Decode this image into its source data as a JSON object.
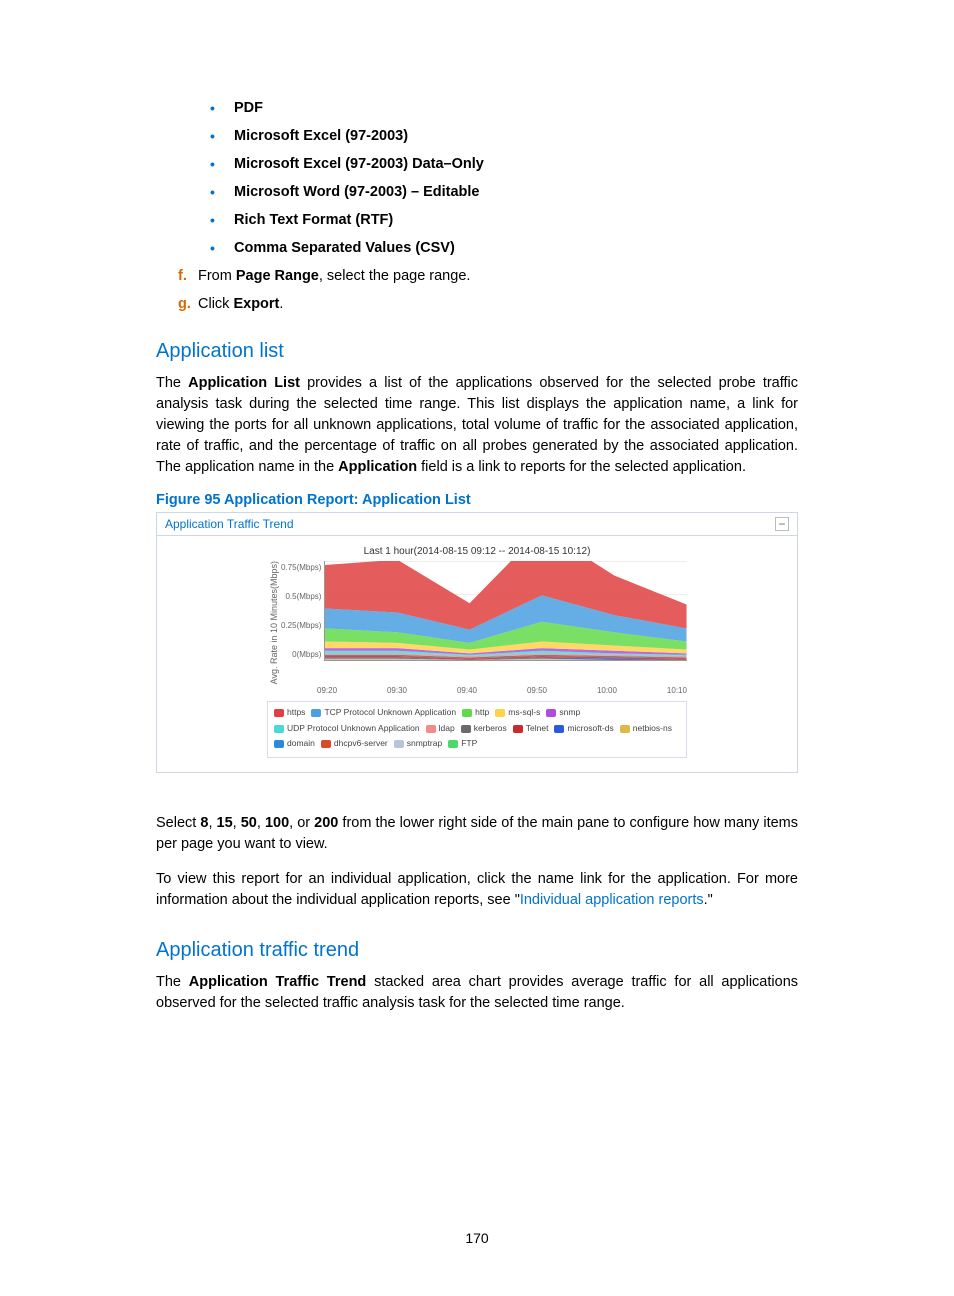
{
  "formats": [
    "PDF",
    "Microsoft Excel (97-2003)",
    "Microsoft Excel (97-2003) Data–Only",
    "Microsoft Word (97-2003) – Editable",
    "Rich Text Format (RTF)",
    "Comma Separated Values (CSV)"
  ],
  "steps": {
    "f": {
      "letter": "f.",
      "prefix": "From ",
      "bold": "Page Range",
      "suffix": ", select the page range."
    },
    "g": {
      "letter": "g.",
      "prefix": "Click ",
      "bold": "Export",
      "suffix": "."
    }
  },
  "section1": {
    "title": "Application list",
    "para_before_bold1": "The ",
    "bold1": "Application List",
    "para_mid": " provides a list of the applications observed for the selected probe traffic analysis task during the selected time range. This list displays the application name, a link for viewing the ports for all unknown applications, total volume of traffic for the associated application, rate of traffic, and the percentage of traffic on all probes generated by the associated application. The application name in the ",
    "bold2": "Application",
    "para_after_bold2": " field is a link to reports for the selected application."
  },
  "figure_caption": "Figure 95 Application Report: Application List",
  "panel_title": "Application Traffic Trend",
  "chart_data": {
    "type": "area",
    "title": "Last 1 hour(2014-08-15 09:12 -- 2014-08-15 10:12)",
    "ylabel": "Avg. Rate in 10 Minutes(Mbps)",
    "y_ticks": [
      "0.75(Mbps)",
      "0.5(Mbps)",
      "0.25(Mbps)",
      "0(Mbps)"
    ],
    "ylim": [
      0,
      0.75
    ],
    "x_ticks": [
      "09:20",
      "09:30",
      "09:40",
      "09:50",
      "10:00",
      "10:10"
    ],
    "x": [
      0,
      0.2,
      0.4,
      0.6,
      0.8,
      1.0
    ],
    "series": [
      {
        "name": "https",
        "color": "#e04040",
        "values": [
          0.33,
          0.4,
          0.2,
          0.5,
          0.3,
          0.18
        ]
      },
      {
        "name": "TCP Protocol Unknown Application",
        "color": "#4aa0e0",
        "values": [
          0.15,
          0.15,
          0.1,
          0.2,
          0.13,
          0.1
        ]
      },
      {
        "name": "http",
        "color": "#62d94a",
        "values": [
          0.1,
          0.08,
          0.05,
          0.15,
          0.1,
          0.06
        ]
      },
      {
        "name": "ms-sql-s",
        "color": "#ffd24a",
        "values": [
          0.05,
          0.04,
          0.03,
          0.05,
          0.04,
          0.03
        ]
      },
      {
        "name": "snmp",
        "color": "#b04ae0",
        "values": [
          0.02,
          0.02,
          0.01,
          0.02,
          0.02,
          0.01
        ]
      },
      {
        "name": "UDP Protocol Unknown Application",
        "color": "#4ad9d9",
        "values": [
          0.02,
          0.02,
          0.01,
          0.02,
          0.01,
          0.01
        ]
      },
      {
        "name": "ldap",
        "color": "#f28b8b",
        "values": [
          0.01,
          0.01,
          0.01,
          0.01,
          0.01,
          0.01
        ]
      },
      {
        "name": "kerberos",
        "color": "#6a6a6a",
        "values": [
          0.01,
          0.01,
          0.01,
          0.01,
          0.01,
          0.01
        ]
      },
      {
        "name": "Telnet",
        "color": "#c92a2a",
        "values": [
          0.01,
          0.01,
          0.01,
          0.01,
          0.01,
          0.01
        ]
      },
      {
        "name": "microsoft-ds",
        "color": "#2a5bd9",
        "values": [
          0.01,
          0.01,
          0.0,
          0.01,
          0.01,
          0.0
        ]
      },
      {
        "name": "netbios-ns",
        "color": "#e0b84a",
        "values": [
          0.01,
          0.01,
          0.0,
          0.01,
          0.0,
          0.0
        ]
      },
      {
        "name": "domain",
        "color": "#2a8bd9",
        "values": [
          0.0,
          0.0,
          0.0,
          0.0,
          0.0,
          0.0
        ]
      },
      {
        "name": "dhcpv6-server",
        "color": "#d94a2a",
        "values": [
          0.0,
          0.0,
          0.0,
          0.0,
          0.0,
          0.0
        ]
      },
      {
        "name": "snmptrap",
        "color": "#b8c4d9",
        "values": [
          0.0,
          0.0,
          0.0,
          0.0,
          0.0,
          0.0
        ]
      },
      {
        "name": "FTP",
        "color": "#4ad96a",
        "values": [
          0.0,
          0.0,
          0.0,
          0.0,
          0.0,
          0.0
        ]
      }
    ]
  },
  "para2": {
    "p1_a": "Select ",
    "b1": "8",
    "c1": ", ",
    "b2": "15",
    "c2": ", ",
    "b3": "50",
    "c3": ", ",
    "b4": "100",
    "c4": ", or ",
    "b5": "200",
    "p1_b": " from the lower right side of the main pane to configure how many items per page you want to view.",
    "p2_a": "To view this report for an individual application, click the name link for the application. For more information about the individual application reports, see \"",
    "link": "Individual application reports",
    "p2_b": ".\""
  },
  "section2": {
    "title": "Application traffic trend",
    "para_a": "The ",
    "bold": "Application Traffic Trend",
    "para_b": " stacked area chart provides average traffic for all applications observed for the selected traffic analysis task for the selected time range."
  },
  "page_number": "170"
}
